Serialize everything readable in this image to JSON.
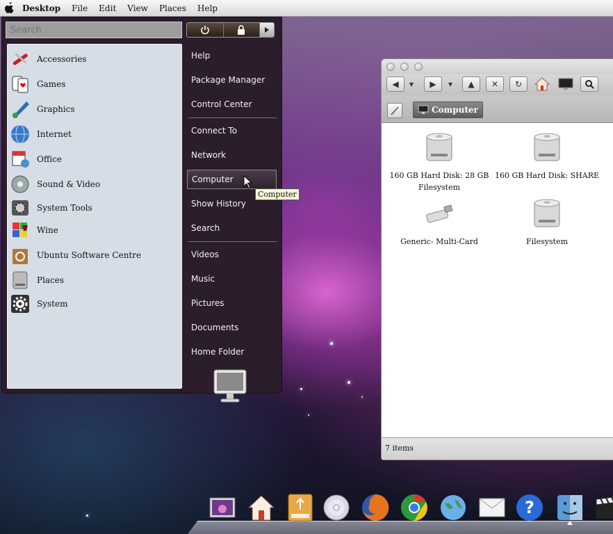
{
  "top_panel": {
    "title": "Desktop",
    "menus": [
      "File",
      "Edit",
      "View",
      "Places",
      "Help"
    ]
  },
  "app_menu": {
    "search_placeholder": "Search",
    "categories": [
      {
        "label": "Accessories",
        "icon": "accessories-icon"
      },
      {
        "label": "Games",
        "icon": "games-icon"
      },
      {
        "label": "Graphics",
        "icon": "graphics-icon"
      },
      {
        "label": "Internet",
        "icon": "internet-globe-icon"
      },
      {
        "label": "Office",
        "icon": "office-icon"
      },
      {
        "label": "Sound & Video",
        "icon": "sound-video-icon"
      },
      {
        "label": "System Tools",
        "icon": "system-tools-icon"
      },
      {
        "label": "Wine",
        "icon": "wine-icon"
      },
      {
        "label": "Ubuntu Software Centre",
        "icon": "software-centre-icon"
      },
      {
        "label": "Places",
        "icon": "places-icon"
      },
      {
        "label": "System",
        "icon": "system-gear-icon"
      }
    ],
    "places": [
      {
        "label": "Help"
      },
      {
        "label": "Package Manager"
      },
      {
        "label": "Control Center"
      },
      {
        "label": "Connect To"
      },
      {
        "label": "Network"
      },
      {
        "label": "Computer"
      },
      {
        "label": "Show History"
      },
      {
        "label": "Search"
      },
      {
        "label": "Videos"
      },
      {
        "label": "Music"
      },
      {
        "label": "Pictures"
      },
      {
        "label": "Documents"
      },
      {
        "label": "Home Folder"
      }
    ],
    "active_place": "Computer"
  },
  "tooltip": "Computer",
  "file_manager": {
    "location": "Computer",
    "items": [
      {
        "label": "160 GB Hard Disk: 28 GB Filesystem",
        "icon": "hard-disk-icon"
      },
      {
        "label": "160 GB Hard Disk: SHARE",
        "icon": "hard-disk-icon"
      },
      {
        "label": "Generic- Multi-Card",
        "icon": "usb-drive-icon"
      },
      {
        "label": "Filesystem",
        "icon": "hard-disk-icon"
      }
    ],
    "status": "7 items"
  },
  "dock": [
    {
      "name": "photo-viewer-icon"
    },
    {
      "name": "home-folder-icon"
    },
    {
      "name": "usb-drive-icon"
    },
    {
      "name": "cd-disc-icon"
    },
    {
      "name": "firefox-icon"
    },
    {
      "name": "chrome-icon"
    },
    {
      "name": "globe-icon"
    },
    {
      "name": "mail-icon"
    },
    {
      "name": "help-icon"
    },
    {
      "name": "finder-icon"
    },
    {
      "name": "movie-clapper-icon"
    }
  ],
  "colors": {
    "menu_bg": "#2b1d2b",
    "category_bg": "#d7dde6",
    "panel_bg": "#e6e6e6"
  }
}
